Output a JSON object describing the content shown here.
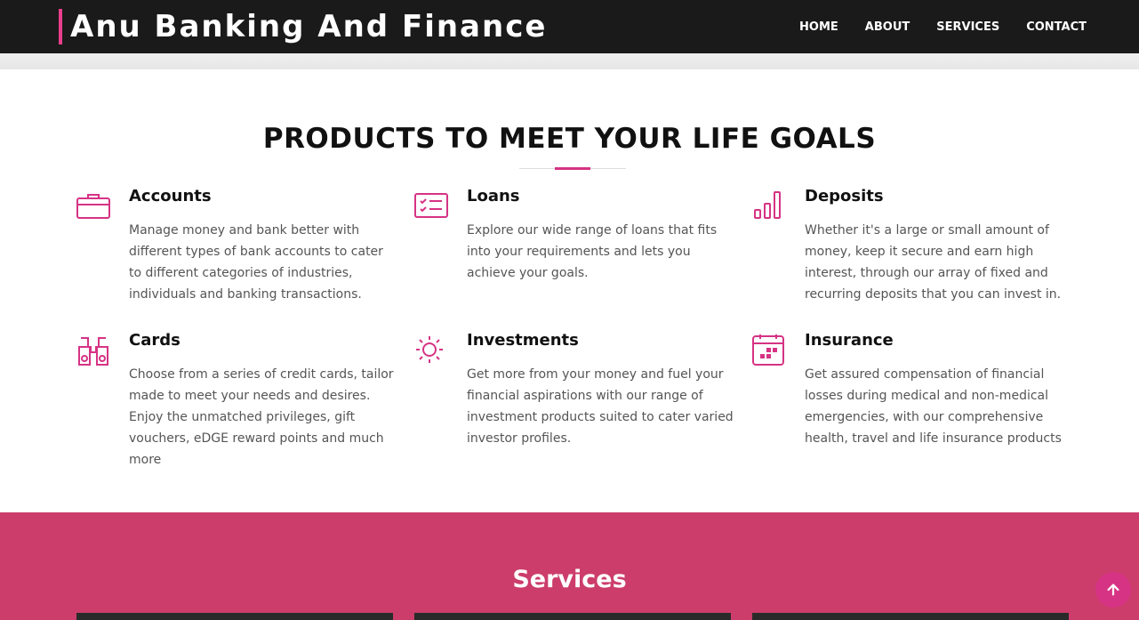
{
  "header": {
    "brand": "Anu Banking And Finance",
    "nav": [
      {
        "label": "HOME"
      },
      {
        "label": "ABOUT"
      },
      {
        "label": "SERVICES"
      },
      {
        "label": "CONTACT"
      }
    ]
  },
  "products": {
    "title": "PRODUCTS TO MEET YOUR LIFE GOALS",
    "items": [
      {
        "icon": "briefcase-icon",
        "title": "Accounts",
        "desc": "Manage money and bank better with different types of bank accounts to cater to different categories of industries, individuals and banking transactions."
      },
      {
        "icon": "checklist-icon",
        "title": "Loans",
        "desc": "Explore our wide range of loans that fits into your requirements and lets you achieve your goals."
      },
      {
        "icon": "bar-chart-icon",
        "title": "Deposits",
        "desc": "Whether it's a large or small amount of money, keep it secure and earn high interest, through our array of fixed and recurring deposits that you can invest in."
      },
      {
        "icon": "binoculars-icon",
        "title": "Cards",
        "desc": "Choose from a series of credit cards, tailor made to meet your needs and desires. Enjoy the unmatched privileges, gift vouchers, eDGE reward points and much more"
      },
      {
        "icon": "sun-icon",
        "title": "Investments",
        "desc": "Get more from your money and fuel your financial aspirations with our range of investment products suited to cater varied investor profiles."
      },
      {
        "icon": "calendar-icon",
        "title": "Insurance",
        "desc": "Get assured compensation of financial losses during medical and non-medical emergencies, with our comprehensive health, travel and life insurance products"
      }
    ]
  },
  "services": {
    "title": "Services"
  },
  "colors": {
    "accent": "#d63384",
    "navbar": "#1a1a1a",
    "services_bg": "#cc3d6c"
  },
  "back_to_top": {
    "icon": "arrow-up-icon"
  }
}
